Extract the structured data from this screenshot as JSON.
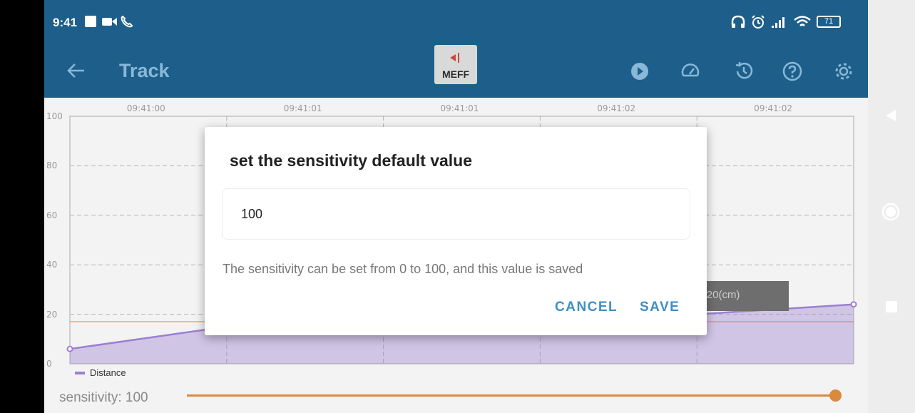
{
  "status_bar": {
    "time": "9:41",
    "battery": "71"
  },
  "app_bar": {
    "title": "Track",
    "logo_text": "MEFF"
  },
  "chart_data": {
    "type": "line",
    "x": [
      "09:41:00",
      "09:41:01",
      "09:41:01",
      "09:41:02",
      "09:41:02"
    ],
    "y_ticks": [
      "100",
      "80",
      "60",
      "40",
      "20",
      "0"
    ],
    "ylim": [
      0,
      100
    ],
    "series": [
      {
        "name": "Distance",
        "points": [
          [
            0,
            6
          ],
          [
            1,
            15
          ],
          [
            2,
            17
          ],
          [
            3,
            18
          ],
          [
            4,
            20
          ],
          [
            5,
            24
          ]
        ]
      }
    ],
    "threshold": 17,
    "tooltip": "=20(cm)",
    "grid": true,
    "legend": "bottom-left"
  },
  "sensitivity": {
    "label": "sensitivity:",
    "value": "100",
    "level": 1.0
  },
  "dialog": {
    "title": "set the sensitivity default value",
    "input_value": "100",
    "hint": "The sensitivity can be set from 0 to 100, and this value is saved",
    "cancel_label": "CANCEL",
    "save_label": "SAVE"
  },
  "colors": {
    "app_bar": "#1d5f8a",
    "series": "#9b7fd0",
    "accent": "#d98a3d",
    "dialog_button": "#3f8fc4"
  },
  "icons": [
    "back-arrow-icon",
    "play-icon",
    "speedometer-icon",
    "history-icon",
    "help-icon",
    "gear-icon"
  ]
}
